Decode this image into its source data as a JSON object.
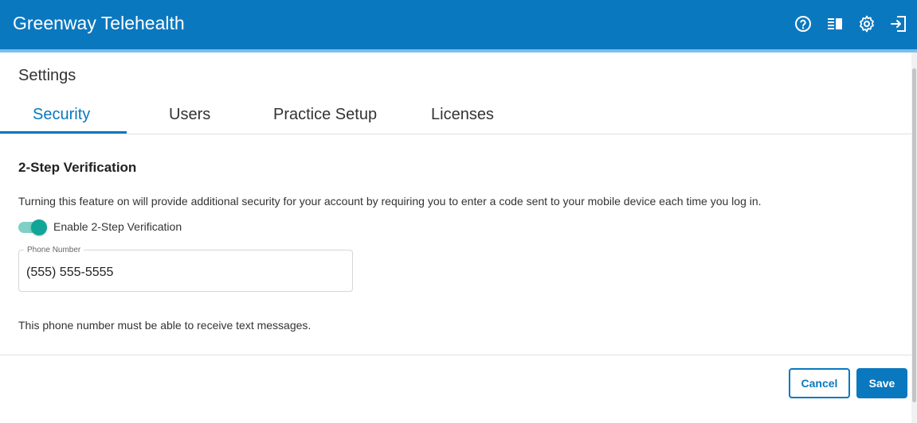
{
  "header": {
    "app_title": "Greenway Telehealth",
    "icons": [
      "help-circle-icon",
      "book-icon",
      "gear-icon",
      "logout-icon"
    ],
    "color": "#0a78bf"
  },
  "page": {
    "title": "Settings"
  },
  "tabs": [
    {
      "label": "Security",
      "active": true
    },
    {
      "label": "Users",
      "active": false
    },
    {
      "label": "Practice Setup",
      "active": false
    },
    {
      "label": "Licenses",
      "active": false
    }
  ],
  "security": {
    "section_title": "2-Step Verification",
    "description": "Turning this feature on will provide additional security for your account by requiring you to enter a code sent to your mobile device each time you log in.",
    "toggle": {
      "label": "Enable 2-Step Verification",
      "enabled": true,
      "color": "#10a596"
    },
    "phone_field": {
      "label": "Phone Number",
      "value": "(555) 555-5555"
    },
    "phone_note": "This phone number must be able to receive text messages."
  },
  "footer": {
    "cancel_label": "Cancel",
    "save_label": "Save"
  }
}
